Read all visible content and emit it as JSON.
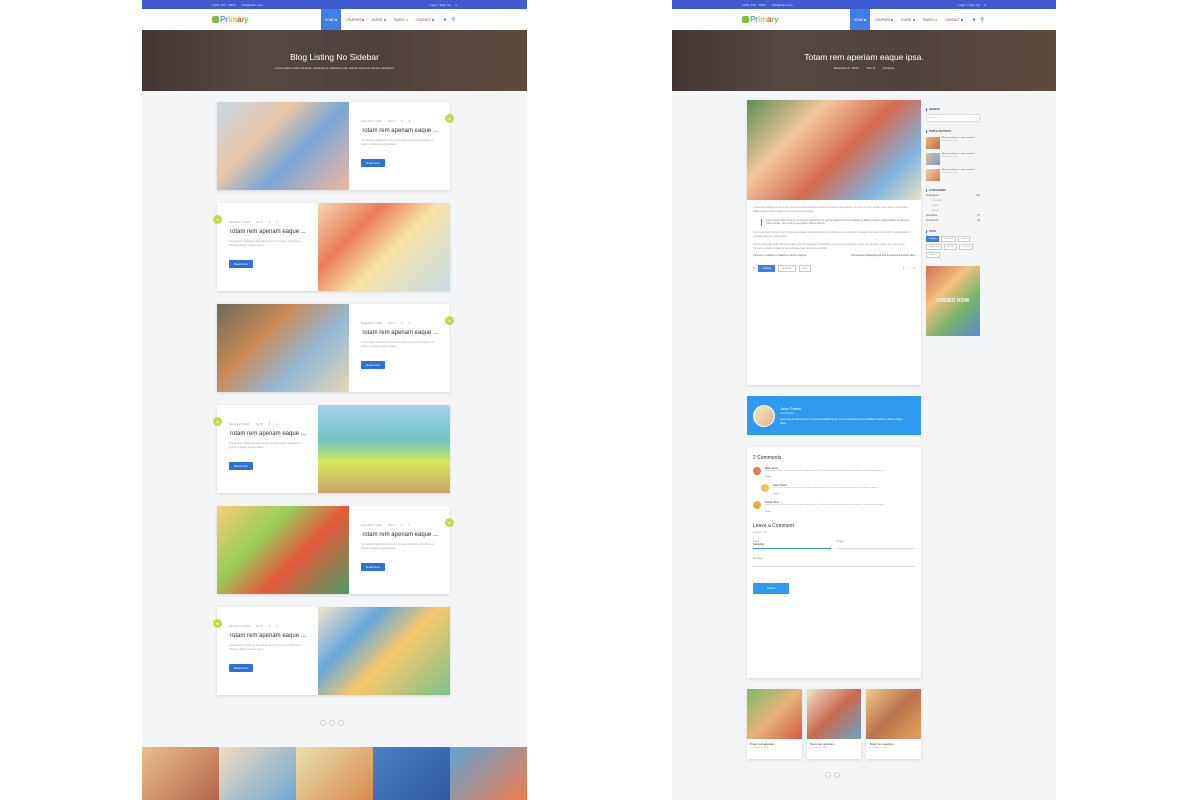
{
  "topbar": {
    "phone": "(123) 123 - 9632",
    "email": "info@kids.com",
    "login": "Login / Sign Up"
  },
  "nav": {
    "logo": {
      "p1": "Pr",
      "p2": "im",
      "p3": "a",
      "p4": "ry"
    },
    "menu": [
      "HOME",
      "COURSES",
      "EVENT",
      "PAGES",
      "CONTACT"
    ]
  },
  "left": {
    "hero_title": "Blog Listing No Sidebar",
    "hero_sub": "Lorem ipsum dolor sit amet, consectetur adipiscing elit, sed do eiusmod tempor incididunt",
    "cards": [
      {
        "date": "December 6, 2016",
        "author": "Tom H",
        "likes": "5",
        "comments": "3",
        "title": "Totam rem aperiam eaque ...",
        "excerpt": "Consectetur adipiscing elit sed do eiusmod tempor incididunt ut labore et dolore magna aliqua.",
        "button": "Read more"
      },
      {
        "date": "December 6, 2016",
        "author": "Tom H",
        "likes": "5",
        "comments": "3",
        "title": "Totam rem aperiam eaque ...",
        "excerpt": "Consectetur adipiscing elit sed do eiusmod tempor incididunt ut labore et dolore magna aliqua.",
        "button": "Read more"
      },
      {
        "date": "December 6, 2016",
        "author": "Tom H",
        "likes": "5",
        "comments": "3",
        "title": "Totam rem aperiam eaque ...",
        "excerpt": "Consectetur adipiscing elit sed do eiusmod tempor incididunt ut labore et dolore magna aliqua.",
        "button": "Read more"
      },
      {
        "date": "December 6, 2016",
        "author": "Tom H",
        "likes": "5",
        "comments": "3",
        "title": "Totam rem aperiam eaque ...",
        "excerpt": "Consectetur adipiscing elit sed do eiusmod tempor incididunt ut labore et dolore magna aliqua.",
        "button": "Read more"
      },
      {
        "date": "December 6, 2016",
        "author": "Tom H",
        "likes": "5",
        "comments": "3",
        "title": "Totam rem aperiam eaque ...",
        "excerpt": "Consectetur adipiscing elit sed do eiusmod tempor incididunt ut labore et dolore magna aliqua.",
        "button": "Read more"
      },
      {
        "date": "December 6, 2016",
        "author": "Tom H",
        "likes": "5",
        "comments": "3",
        "title": "Totam rem aperiam eaque ...",
        "excerpt": "Consectetur adipiscing elit sed do eiusmod tempor incididunt ut labore et dolore magna aliqua.",
        "button": "Read more"
      }
    ],
    "pager": [
      "‹",
      "1",
      "›"
    ]
  },
  "right": {
    "hero_title": "Totam rem aperiam eaque ipsa.",
    "hero_date": "December 6, 2016",
    "hero_author": "Tom H",
    "hero_category": "Campus",
    "article_p1": "Consectetur adipiscing elit sed do eiusmod tempor incididunt ut labore et dolore magna aliqua. Ut enim ad minim veniam, quis nostrud exercitation ullamco laboris nisi ut aliquip ex ea commodo consequat.",
    "quote": "Lorem ipsum dolor sit amet, consectetur adipiscing elit, sed do eiusmod tempor incididunt ut labore et dolore magna aliqua. Ut enim ad minim veniam, quis nostrud exercitation ullamco laboris.",
    "article_p2": "Ut enim ad minim veniam, quis nostrud exercitation ullamco laboris nisi ut aliquip ex ea commodo consequat. Duis aute irure dolor in reprehenderit in voluptate velit esse cillum dolore.",
    "article_p3": "Sed ut perspiciatis unde omnis iste natus error sit voluptatem accusantium doloremque laudantium, totam rem aperiam, eaque ipsa quae ab illo inventore veritatis et quasi architecto beatae vitae dicta sunt explicabo.",
    "prev_post": "Previous: Incididunt ut labore et dolore magna",
    "next_post": "Consectetur adipiscing elit sed do eiusmod tempor Next",
    "tags": [
      "Campus",
      "Students",
      "Fun"
    ],
    "author": {
      "name": "Jane Parker",
      "role": "Administrator",
      "bio": "Lorem ipsum dolor sit amet, consectetur adipiscing elit, sed do eiusmod tempor incididunt ut labore et dolore magna aliqua."
    },
    "comments_title": "2 Comments",
    "comments": [
      {
        "name": "Mark Jones",
        "text": "Lorem ipsum dolor sit amet, consectetur adipiscing elit, sed do eiusmod tempor incididunt ut labore et dolore magna aliqua.",
        "reply": "Reply"
      },
      {
        "name": "Jane Parker",
        "text": "Lorem ipsum dolor sit amet, consectetur adipiscing elit, sed do eiusmod tempor incididunt ut labore et dolore.",
        "reply": "Reply"
      },
      {
        "name": "Kristie Ulme",
        "text": "Lorem ipsum dolor sit amet, consectetur adipiscing elit, sed do eiusmod tempor incididunt ut labore et dolore magna aliqua.",
        "reply": "Reply"
      }
    ],
    "leave": {
      "title": "Leave a Comment",
      "small": "Connect with:",
      "name_label": "Name",
      "name_value": "Samantha",
      "email_label": "Email",
      "message_label": "Message",
      "submit": "Submit"
    },
    "related": [
      {
        "title": "Totam rem aperiam...",
        "date": "December 6, 2016"
      },
      {
        "title": "Totam rem aperiam...",
        "date": "December 6, 2016"
      },
      {
        "title": "Totam rem aperiam...",
        "date": "December 6, 2016"
      }
    ],
    "pager": [
      "‹",
      "›"
    ]
  },
  "sidebar": {
    "search_title": "SEARCH",
    "search_placeholder": "Search...",
    "popular_title": "POPULAR POSTS",
    "popular": [
      {
        "title": "How to guide Ho a wider student?",
        "date": "December 6, 2016"
      },
      {
        "title": "How to guide Ho a wider student?",
        "date": "December 6, 2016"
      },
      {
        "title": "How to guide Ho a wider student?",
        "date": "December 6, 2016"
      }
    ],
    "categories_title": "CATEGORIES",
    "categories": [
      {
        "name": "Kindergarten",
        "count": "(12)",
        "sub": false
      },
      {
        "name": "Preschool",
        "count": "",
        "sub": true
      },
      {
        "name": "Junior",
        "count": "",
        "sub": true
      },
      {
        "name": "Senior",
        "count": "",
        "sub": true
      },
      {
        "name": "Specialists",
        "count": "(7)",
        "sub": false
      },
      {
        "name": "Accessories",
        "count": "(8)",
        "sub": false
      }
    ],
    "tags_title": "TAGS",
    "tags": [
      "Campus",
      "Education",
      "School",
      "Workshops",
      "Teacher",
      "Learning",
      "Students"
    ],
    "banner": "ORDER NOW"
  }
}
